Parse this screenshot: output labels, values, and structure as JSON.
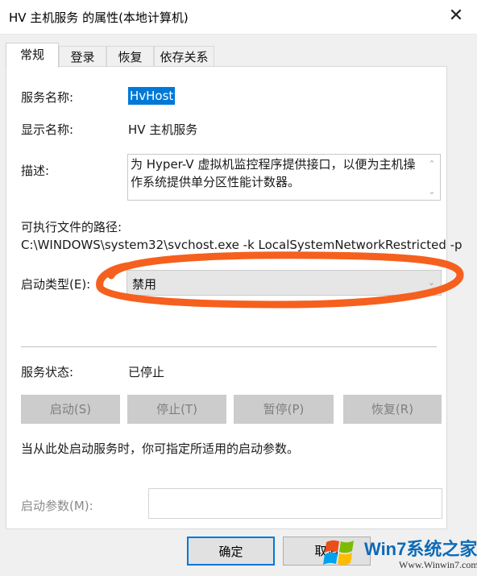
{
  "window": {
    "title": "HV 主机服务 的属性(本地计算机)",
    "close_glyph": "✕"
  },
  "tabs": [
    {
      "label": "常规",
      "active": true
    },
    {
      "label": "登录",
      "active": false
    },
    {
      "label": "恢复",
      "active": false
    },
    {
      "label": "依存关系",
      "active": false
    }
  ],
  "general": {
    "service_name_label": "服务名称:",
    "service_name_value": "HvHost",
    "display_name_label": "显示名称:",
    "display_name_value": "HV 主机服务",
    "description_label": "描述:",
    "description_value": "为 Hyper-V 虚拟机监控程序提供接口，以便为主机操作系统提供单分区性能计数器。",
    "path_label": "可执行文件的路径:",
    "path_value": "C:\\WINDOWS\\system32\\svchost.exe -k LocalSystemNetworkRestricted -p",
    "startup_type_label": "启动类型(E):",
    "startup_type_value": "禁用",
    "status_label": "服务状态:",
    "status_value": "已停止",
    "service_buttons": {
      "start": "启动(S)",
      "stop": "停止(T)",
      "pause": "暂停(P)",
      "resume": "恢复(R)"
    },
    "hint_text": "当从此处启动服务时，你可指定所适用的启动参数。",
    "start_params_label": "启动参数(M):",
    "start_params_value": ""
  },
  "footer": {
    "ok_label": "确定",
    "cancel_label": "取消"
  },
  "watermark": {
    "text": "Win7系统之家",
    "url": "Www.Winwin7.com"
  },
  "colors": {
    "selection": "#0078d7",
    "annotation": "#f5601e",
    "disabled_button": "#cccccc",
    "panel": "#ffffff",
    "window_bg": "#f0f0f0"
  },
  "icons": {
    "close": "close-icon",
    "scroll_up": "chevron-up-icon",
    "scroll_down": "chevron-down-icon",
    "dropdown": "chevron-down-icon"
  }
}
